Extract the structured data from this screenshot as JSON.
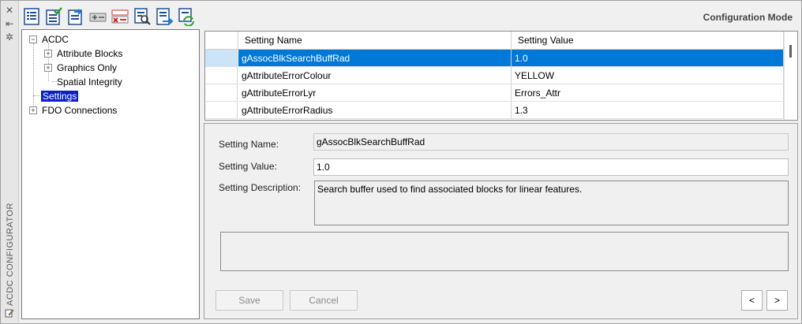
{
  "window": {
    "title": "ACDC CONFIGURATOR",
    "close_glyph": "✕",
    "pin_glyph": "⇤",
    "settings_glyph": "✲"
  },
  "toolbar": {
    "icons": [
      "properties-icon",
      "validate-icon",
      "export-icon",
      "add-row-icon",
      "delete-row-icon",
      "find-icon",
      "import-icon",
      "refresh-icon"
    ],
    "mode_label": "Configuration Mode"
  },
  "tree": {
    "nodes": [
      {
        "label": "ACDC",
        "expander": "−"
      },
      {
        "label": "Attribute Blocks",
        "expander": "+"
      },
      {
        "label": "Graphics Only",
        "expander": "+"
      },
      {
        "label": "Spatial Integrity",
        "expander": ""
      },
      {
        "label": "Settings",
        "expander": ""
      },
      {
        "label": "FDO Connections",
        "expander": "+"
      }
    ]
  },
  "grid": {
    "columns": [
      "Setting Name",
      "Setting Value"
    ],
    "rows": [
      {
        "name": "gAssocBlkSearchBuffRad",
        "value": "1.0"
      },
      {
        "name": "gAttributeErrorColour",
        "value": "YELLOW"
      },
      {
        "name": "gAttributeErrorLyr",
        "value": "Errors_Attr"
      },
      {
        "name": "gAttributeErrorRadius",
        "value": "1.3"
      }
    ]
  },
  "detail": {
    "name_label": "Setting Name:",
    "name_value": "gAssocBlkSearchBuffRad",
    "value_label": "Setting Value:",
    "value_value": "1.0",
    "desc_label": "Setting Description:",
    "desc_value": "Search buffer used to find associated blocks for linear features.",
    "save_label": "Save",
    "cancel_label": "Cancel",
    "prev_label": "<",
    "next_label": ">"
  }
}
